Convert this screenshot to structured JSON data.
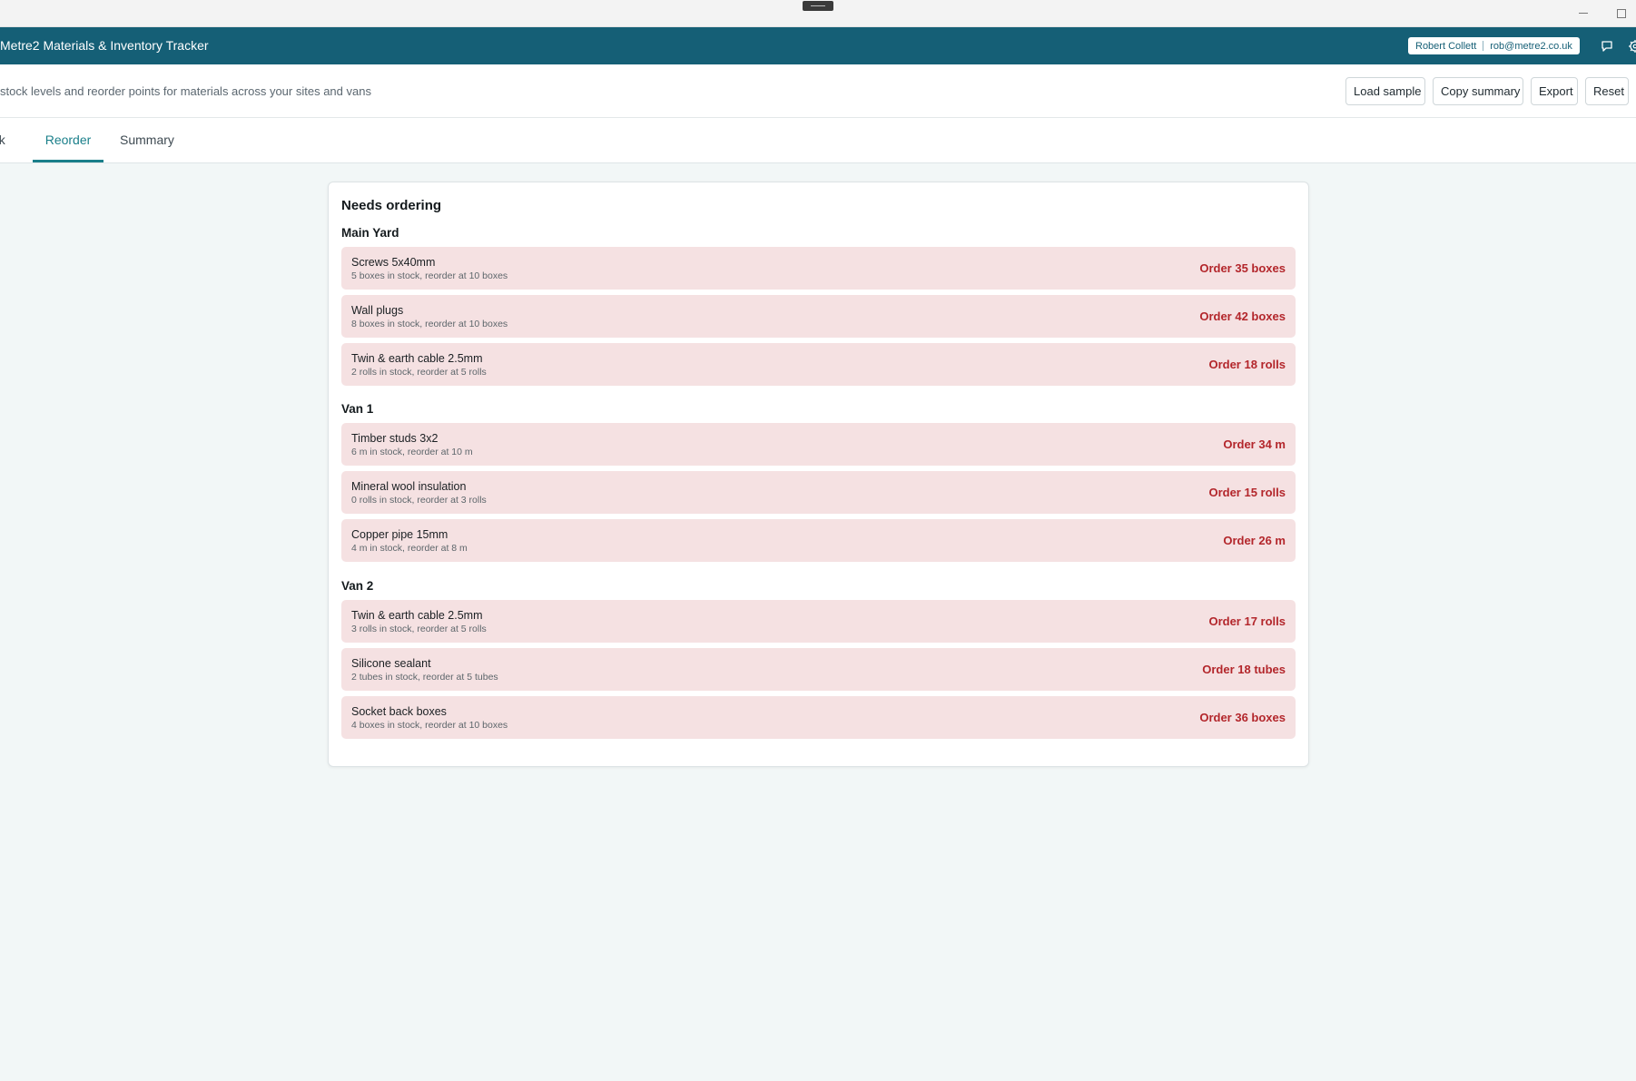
{
  "window": {
    "minimize_label": "—",
    "maximize_label": "□"
  },
  "header": {
    "title": "Metre2 Materials & Inventory Tracker",
    "user_name": "Robert Collett",
    "user_email": "rob@metre2.co.uk",
    "icons": [
      "chat-icon",
      "gear-icon"
    ],
    "brand_color": "#155f76"
  },
  "toolbar": {
    "subtitle": "stock levels and reorder points for materials across your sites and vans",
    "load_sample": "Load sample",
    "copy_summary": "Copy summary",
    "export": "Export",
    "reset": "Reset"
  },
  "tabs": [
    {
      "label": "ock",
      "active": false
    },
    {
      "label": "Reorder",
      "active": true
    },
    {
      "label": "Summary",
      "active": false
    }
  ],
  "accent_color": "#1a7f8a",
  "order_color": "#b3262b",
  "reorder": {
    "title": "Needs ordering",
    "groups": [
      {
        "name": "Main Yard",
        "items": [
          {
            "name": "Screws 5x40mm",
            "detail": "5 boxes in stock, reorder at 10 boxes",
            "order": "Order 35 boxes"
          },
          {
            "name": "Wall plugs",
            "detail": "8 boxes in stock, reorder at 10 boxes",
            "order": "Order 42 boxes"
          },
          {
            "name": "Twin & earth cable 2.5mm",
            "detail": "2 rolls in stock, reorder at 5 rolls",
            "order": "Order 18 rolls"
          }
        ]
      },
      {
        "name": "Van 1",
        "items": [
          {
            "name": "Timber studs 3x2",
            "detail": "6 m in stock, reorder at 10 m",
            "order": "Order 34 m"
          },
          {
            "name": "Mineral wool insulation",
            "detail": "0 rolls in stock, reorder at 3 rolls",
            "order": "Order 15 rolls"
          },
          {
            "name": "Copper pipe 15mm",
            "detail": "4 m in stock, reorder at 8 m",
            "order": "Order 26 m"
          }
        ]
      },
      {
        "name": "Van 2",
        "items": [
          {
            "name": "Twin & earth cable 2.5mm",
            "detail": "3 rolls in stock, reorder at 5 rolls",
            "order": "Order 17 rolls"
          },
          {
            "name": "Silicone sealant",
            "detail": "2 tubes in stock, reorder at 5 tubes",
            "order": "Order 18 tubes"
          },
          {
            "name": "Socket back boxes",
            "detail": "4 boxes in stock, reorder at 10 boxes",
            "order": "Order 36 boxes"
          }
        ]
      }
    ]
  }
}
